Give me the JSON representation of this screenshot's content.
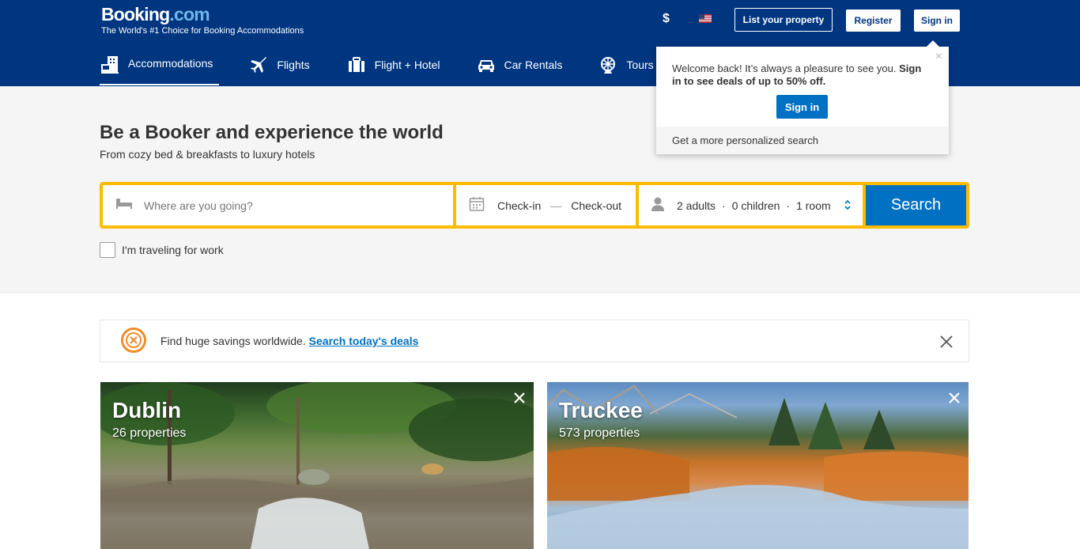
{
  "header": {
    "logo_main": "Booking",
    "logo_suffix": ".com",
    "tagline": "The World's #1 Choice for Booking Accommodations",
    "currency": "$",
    "list_property": "List your property",
    "register": "Register",
    "sign_in": "Sign in"
  },
  "nav": {
    "items": [
      {
        "label": "Accommodations",
        "icon": "bed-icon",
        "active": true
      },
      {
        "label": "Flights",
        "icon": "plane-icon"
      },
      {
        "label": "Flight + Hotel",
        "icon": "suitcase-icon"
      },
      {
        "label": "Car Rentals",
        "icon": "car-icon"
      },
      {
        "label": "Tours",
        "icon": "ferris-wheel-icon"
      }
    ]
  },
  "popover": {
    "message": "Welcome back! It’s always a pleasure to see you.",
    "message_bold": "Sign in to see deals of up to 50% off.",
    "button": "Sign in",
    "footer": "Get a more personalized search",
    "close": "×"
  },
  "hero": {
    "title": "Be a Booker and experience the world",
    "subtitle": "From cozy bed & breakfasts to luxury hotels"
  },
  "search": {
    "destination_placeholder": "Where are you going?",
    "check_in": "Check-in",
    "date_separator": "—",
    "check_out": "Check-out",
    "adults": "2 adults",
    "children": "0 children",
    "rooms": "1 room",
    "guest_separator": "·",
    "button": "Search",
    "work_label": "I'm traveling for work"
  },
  "deals": {
    "text": "Find huge savings worldwide.",
    "link": "Search today's deals"
  },
  "cards": [
    {
      "name": "Dublin",
      "count": "26 properties"
    },
    {
      "name": "Truckee",
      "count": "573 properties"
    }
  ],
  "colors": {
    "brand_blue": "#003580",
    "accent_yellow": "#febb02",
    "action_blue": "#0071c2"
  }
}
